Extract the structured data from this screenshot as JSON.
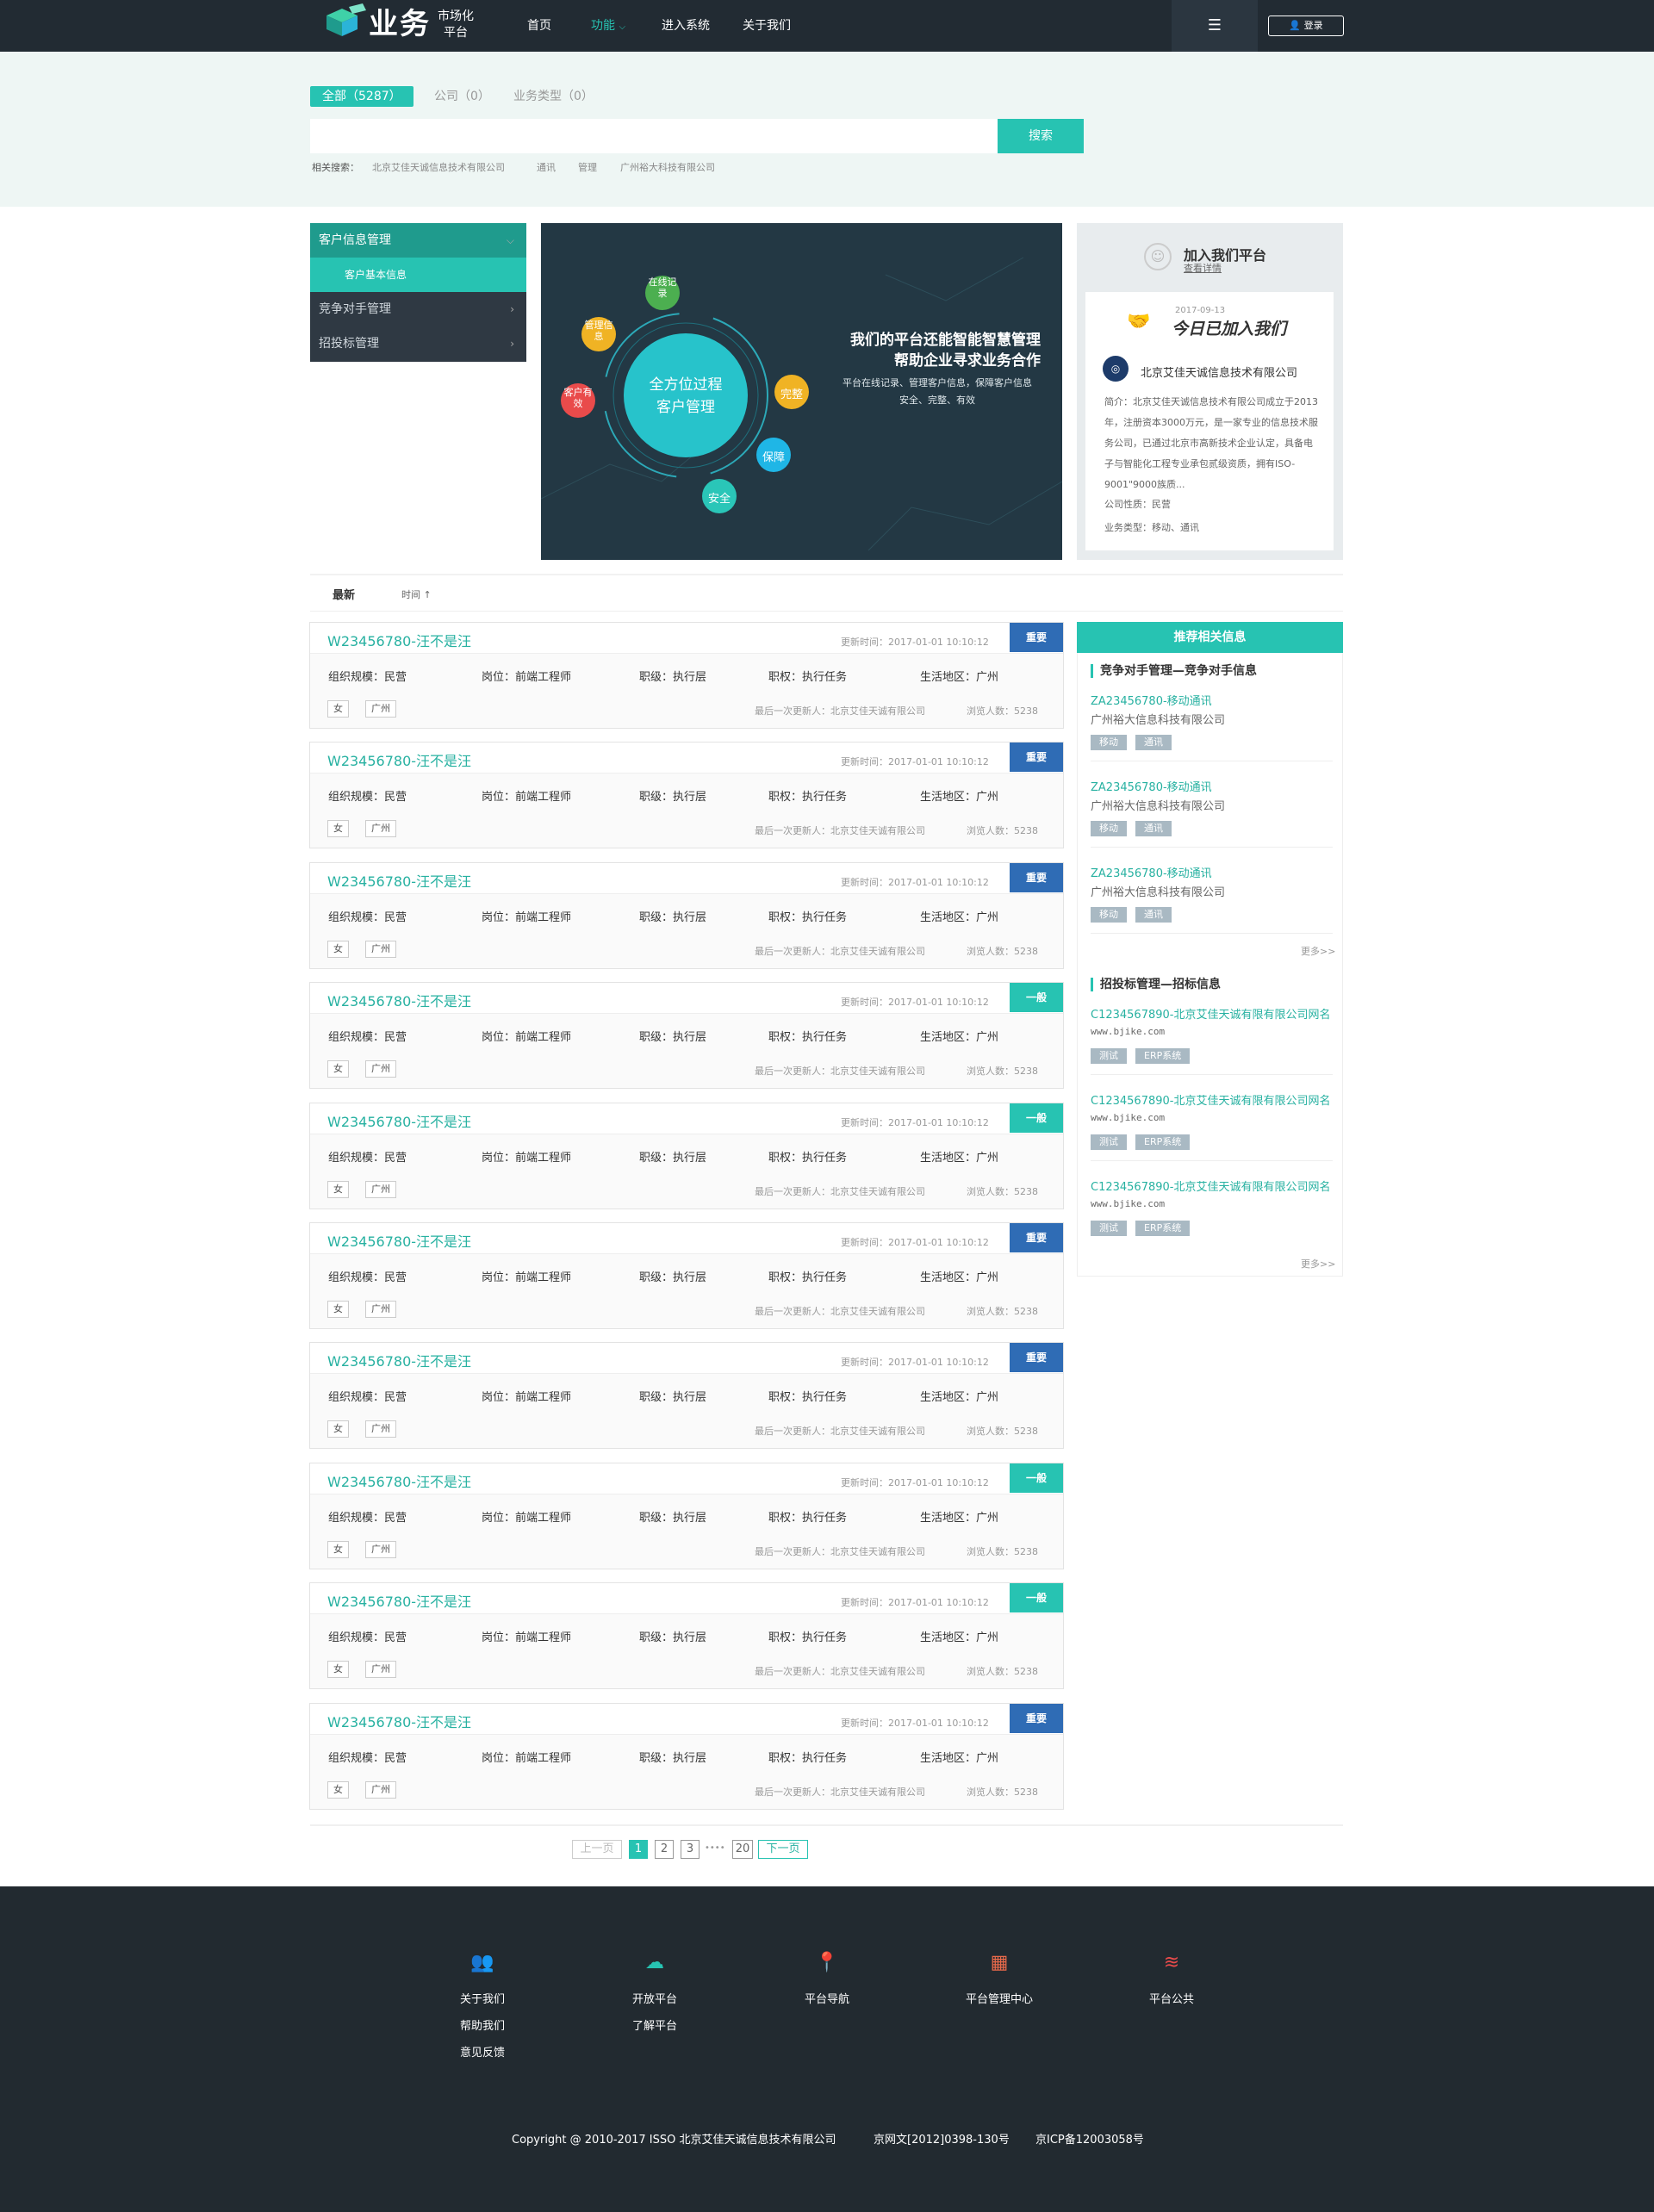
{
  "header": {
    "logo_title": "业务",
    "logo_sub1": "市场化",
    "logo_sub2": "平台",
    "nav": [
      "首页",
      "功能",
      "进入系统",
      "关于我们"
    ],
    "menu_icon": "☰",
    "login": "登录"
  },
  "search": {
    "tabs": [
      "全部（5287）",
      "公司（0）",
      "业务类型（0）"
    ],
    "placeholder": "",
    "button": "搜索",
    "related_label": "相关搜索：",
    "related": [
      "北京艾佳天诚信息技术有限公司",
      "通讯",
      "管理",
      "广州裕大科技有限公司"
    ]
  },
  "sidebar": {
    "items": [
      {
        "label": "客户信息管理",
        "arrow": "⌵"
      },
      {
        "label": "客户基本信息",
        "arrow": ""
      },
      {
        "label": "竞争对手管理",
        "arrow": "›"
      },
      {
        "label": "招投标管理",
        "arrow": "›"
      }
    ]
  },
  "banner": {
    "center1": "全方位过程",
    "center2": "客户管理",
    "bubbles": [
      "在线记录",
      "管理信息",
      "客户有效",
      "完整",
      "保障",
      "安全"
    ],
    "headline1": "我们的平台还能智能智慧管理",
    "headline2": "帮助企业寻求业务合作",
    "desc1": "平台在线记录、管理客户信息，保障客户信息",
    "desc2": "安全、完整、有效"
  },
  "join": {
    "title": "加入我们平台",
    "link": "查看详情",
    "date": "2017-09-13",
    "today": "今日已加入我们",
    "company": "北京艾佳天诚信息技术有限公司",
    "intro": "简介：北京艾佳天诚信息技术有限公司成立于2013年，注册资本3000万元，是一家专业的信息技术服务公司，已通过北京市高新技术企业认定，具备电子与智能化工程专业承包贰级资质，拥有ISO-9001\"9000族质...",
    "nature": "公司性质：民营",
    "type": "业务类型：移动、通讯"
  },
  "sort": {
    "latest": "最新",
    "time": "时间 ↑"
  },
  "list": {
    "time_label": "更新时间：2017-01-01  10:10:12",
    "field_scale": "组织规模：民营",
    "field_post": "岗位：前端工程师",
    "field_level": "职级：执行层",
    "field_power": "职权：执行任务",
    "field_area": "生活地区：广州",
    "tag1": "女",
    "tag2": "广州",
    "last_update": "最后一次更新人：北京艾佳天诚有限公司",
    "views": "浏览人数：5238",
    "items": [
      {
        "title": "W23456780-汪不是汪",
        "badge": "重要",
        "color": "#2f6cb5"
      },
      {
        "title": "W23456780-汪不是汪",
        "badge": "重要",
        "color": "#2f6cb5"
      },
      {
        "title": "W23456780-汪不是汪",
        "badge": "重要",
        "color": "#2f6cb5"
      },
      {
        "title": "W23456780-汪不是汪",
        "badge": "一般",
        "color": "#27c3b2"
      },
      {
        "title": "W23456780-汪不是汪",
        "badge": "一般",
        "color": "#27c3b2"
      },
      {
        "title": "W23456780-汪不是汪",
        "badge": "重要",
        "color": "#2f6cb5"
      },
      {
        "title": "W23456780-汪不是汪",
        "badge": "重要",
        "color": "#2f6cb5"
      },
      {
        "title": "W23456780-汪不是汪",
        "badge": "一般",
        "color": "#27c3b2"
      },
      {
        "title": "W23456780-汪不是汪",
        "badge": "一般",
        "color": "#27c3b2"
      },
      {
        "title": "W23456780-汪不是汪",
        "badge": "重要",
        "color": "#2f6cb5"
      }
    ]
  },
  "recs": {
    "header": "推荐相关信息",
    "sec1": "竞争对手管理—竞争对手信息",
    "sec1_items": [
      {
        "title": "ZA23456780-移动通讯",
        "sub": "广州裕大信息科技有限公司",
        "tags": [
          "移动",
          "通讯"
        ]
      },
      {
        "title": "ZA23456780-移动通讯",
        "sub": "广州裕大信息科技有限公司",
        "tags": [
          "移动",
          "通讯"
        ]
      },
      {
        "title": "ZA23456780-移动通讯",
        "sub": "广州裕大信息科技有限公司",
        "tags": [
          "移动",
          "通讯"
        ]
      }
    ],
    "more": "更多>>",
    "sec2": "招投标管理—招标信息",
    "sec2_items": [
      {
        "title": "C1234567890-北京艾佳天诚有限有限公司网名",
        "url": "www.bjike.com",
        "tags": [
          "测试",
          "ERP系统"
        ]
      },
      {
        "title": "C1234567890-北京艾佳天诚有限有限公司网名",
        "url": "www.bjike.com",
        "tags": [
          "测试",
          "ERP系统"
        ]
      },
      {
        "title": "C1234567890-北京艾佳天诚有限有限公司网名",
        "url": "www.bjike.com",
        "tags": [
          "测试",
          "ERP系统"
        ]
      }
    ]
  },
  "pagination": {
    "prev": "上一页",
    "pages": [
      "1",
      "2",
      "3"
    ],
    "dots": "••••",
    "last": "20",
    "next": "下一页"
  },
  "footer": {
    "cols": [
      {
        "icon": "users-icon",
        "links": [
          "关于我们",
          "帮助我们",
          "意见反馈"
        ]
      },
      {
        "icon": "cloud-icon",
        "links": [
          "开放平台",
          "了解平台"
        ]
      },
      {
        "icon": "map-pin-icon",
        "links": [
          "平台导航"
        ]
      },
      {
        "icon": "grid-icon",
        "links": [
          "平台管理中心"
        ]
      },
      {
        "icon": "layers-icon",
        "links": [
          "平台公共"
        ]
      }
    ],
    "copyright": "Copyright @ 2010-2017 ISSO 北京艾佳天诚信息技术有限公司",
    "license1": "京网文[2012]0398-130号",
    "license2": "京ICP备12003058号"
  }
}
